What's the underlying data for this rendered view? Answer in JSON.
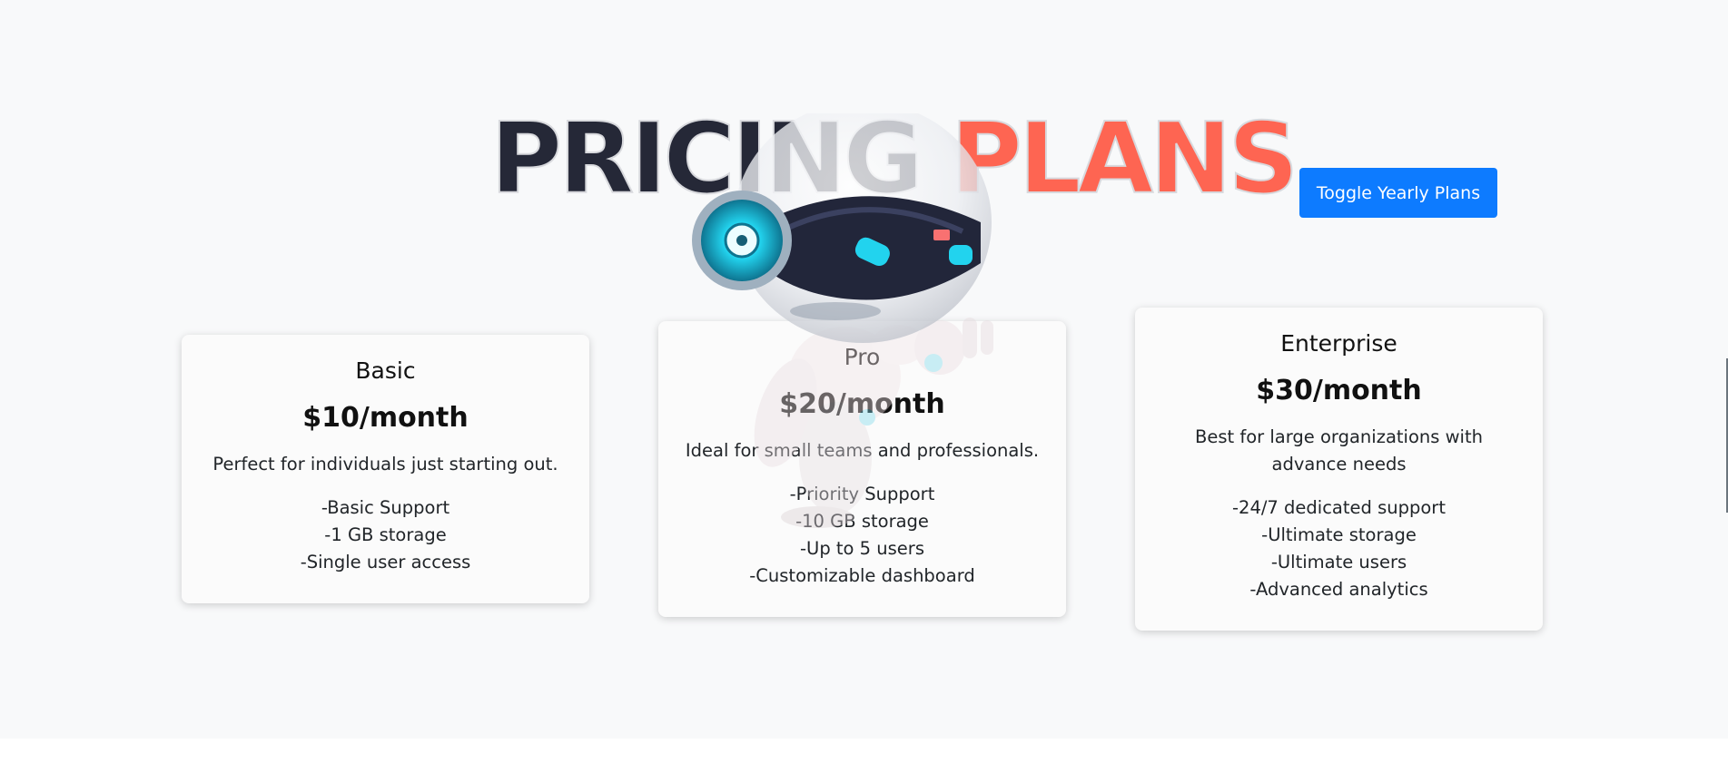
{
  "headline": {
    "word1": "PRICING",
    "word2": "PLANS"
  },
  "toggle": {
    "label": "Toggle Yearly Plans"
  },
  "plans": [
    {
      "name": "Basic",
      "price": "$10/month",
      "description": "Perfect for individuals just starting out.",
      "features": [
        "-Basic Support",
        "-1 GB storage",
        "-Single user access"
      ]
    },
    {
      "name": "Pro",
      "price": "$20/month",
      "description": "Ideal for small teams and professionals.",
      "features": [
        "-Priority Support",
        "-10 GB storage",
        "-Up to 5 users",
        "-Customizable dashboard"
      ]
    },
    {
      "name": "Enterprise",
      "price": "$30/month",
      "description": "Best for large organizations with advance needs",
      "features": [
        "-24/7 dedicated support",
        "-Ultimate storage",
        "-Ultimate users",
        "-Advanced analytics"
      ]
    }
  ],
  "colors": {
    "section_bg": "#f8f9fa",
    "headline_dark": "#252837",
    "headline_accent": "#fe6552",
    "button": "#0d7bff",
    "robot_glow": "#22d3ee"
  },
  "icons": {
    "mascot": "robot-mascot-icon"
  }
}
